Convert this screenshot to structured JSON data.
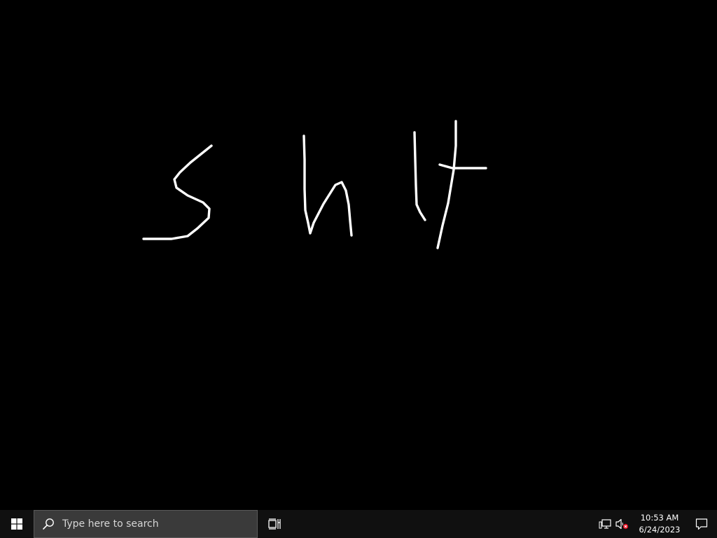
{
  "desktop": {
    "background_color": "#000000",
    "ink_color": "#ffffff"
  },
  "taskbar": {
    "start_icon": "windows-logo-icon",
    "search": {
      "icon": "search-icon",
      "placeholder": "Type here to search"
    },
    "task_view_icon": "task-view-icon",
    "tray": {
      "network_icon": "network-icon",
      "volume_icon": "volume-muted-icon",
      "time": "10:53 AM",
      "date": "6/24/2023",
      "notifications_icon": "action-center-icon"
    }
  }
}
